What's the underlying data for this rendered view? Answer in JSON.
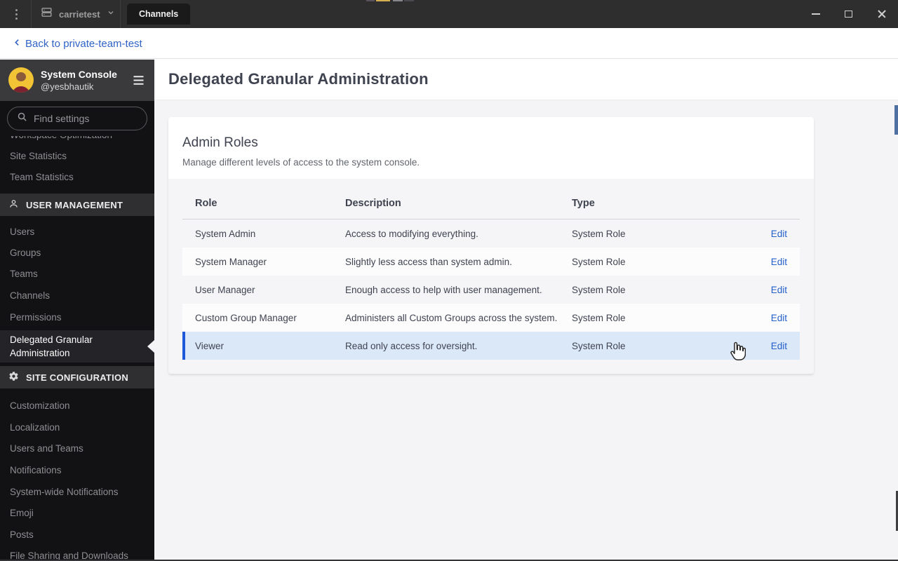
{
  "colors": {
    "accent_blue": "#1c58d9",
    "link_blue": "#2460c9",
    "row_highlight": "#dbe8f8",
    "titlebar_bg": "#2e2e2e",
    "sidebar_bg": "#121214",
    "sidebar_header_bg": "#3a3a3c",
    "section_header_bg": "#2f2f32",
    "content_bg": "#f4f4f6",
    "table_bg": "#f5f5f7",
    "text_dark": "#3f4350"
  },
  "titlebar": {
    "server_name": "carrietest",
    "tab_label": "Channels",
    "window_controls": [
      "minimize",
      "maximize",
      "close"
    ]
  },
  "backbar": {
    "label": "Back to private-team-test"
  },
  "sidebar": {
    "title": "System Console",
    "subtitle": "@yesbhautik",
    "search_placeholder": "Find settings",
    "items": [
      {
        "label": "Workspace Optimization",
        "state": "clipped-top"
      },
      {
        "label": "Site Statistics"
      },
      {
        "label": "Team Statistics"
      },
      {
        "label": "USER MANAGEMENT",
        "type": "section",
        "icon": "user-icon"
      },
      {
        "label": "Users"
      },
      {
        "label": "Groups"
      },
      {
        "label": "Teams"
      },
      {
        "label": "Channels"
      },
      {
        "label": "Permissions"
      },
      {
        "label": "Delegated Granular Administration",
        "state": "active"
      },
      {
        "label": "SITE CONFIGURATION",
        "type": "section",
        "icon": "gear-icon"
      },
      {
        "label": "Customization"
      },
      {
        "label": "Localization"
      },
      {
        "label": "Users and Teams"
      },
      {
        "label": "Notifications"
      },
      {
        "label": "System-wide Notifications"
      },
      {
        "label": "Emoji"
      },
      {
        "label": "Posts"
      },
      {
        "label": "File Sharing and Downloads",
        "state": "clipped-bottom"
      }
    ]
  },
  "main": {
    "page_title": "Delegated Granular Administration",
    "card": {
      "title": "Admin Roles",
      "description": "Manage different levels of access to the system console.",
      "table": {
        "columns": [
          "Role",
          "Description",
          "Type"
        ],
        "action_label": "Edit",
        "rows": [
          {
            "role": "System Admin",
            "description": "Access to modifying everything.",
            "type": "System Role"
          },
          {
            "role": "System Manager",
            "description": "Slightly less access than system admin.",
            "type": "System Role"
          },
          {
            "role": "User Manager",
            "description": "Enough access to help with user management.",
            "type": "System Role"
          },
          {
            "role": "Custom Group Manager",
            "description": "Administers all Custom Groups across the system.",
            "type": "System Role"
          },
          {
            "role": "Viewer",
            "description": "Read only access for oversight.",
            "type": "System Role",
            "highlighted": true
          }
        ]
      }
    }
  }
}
